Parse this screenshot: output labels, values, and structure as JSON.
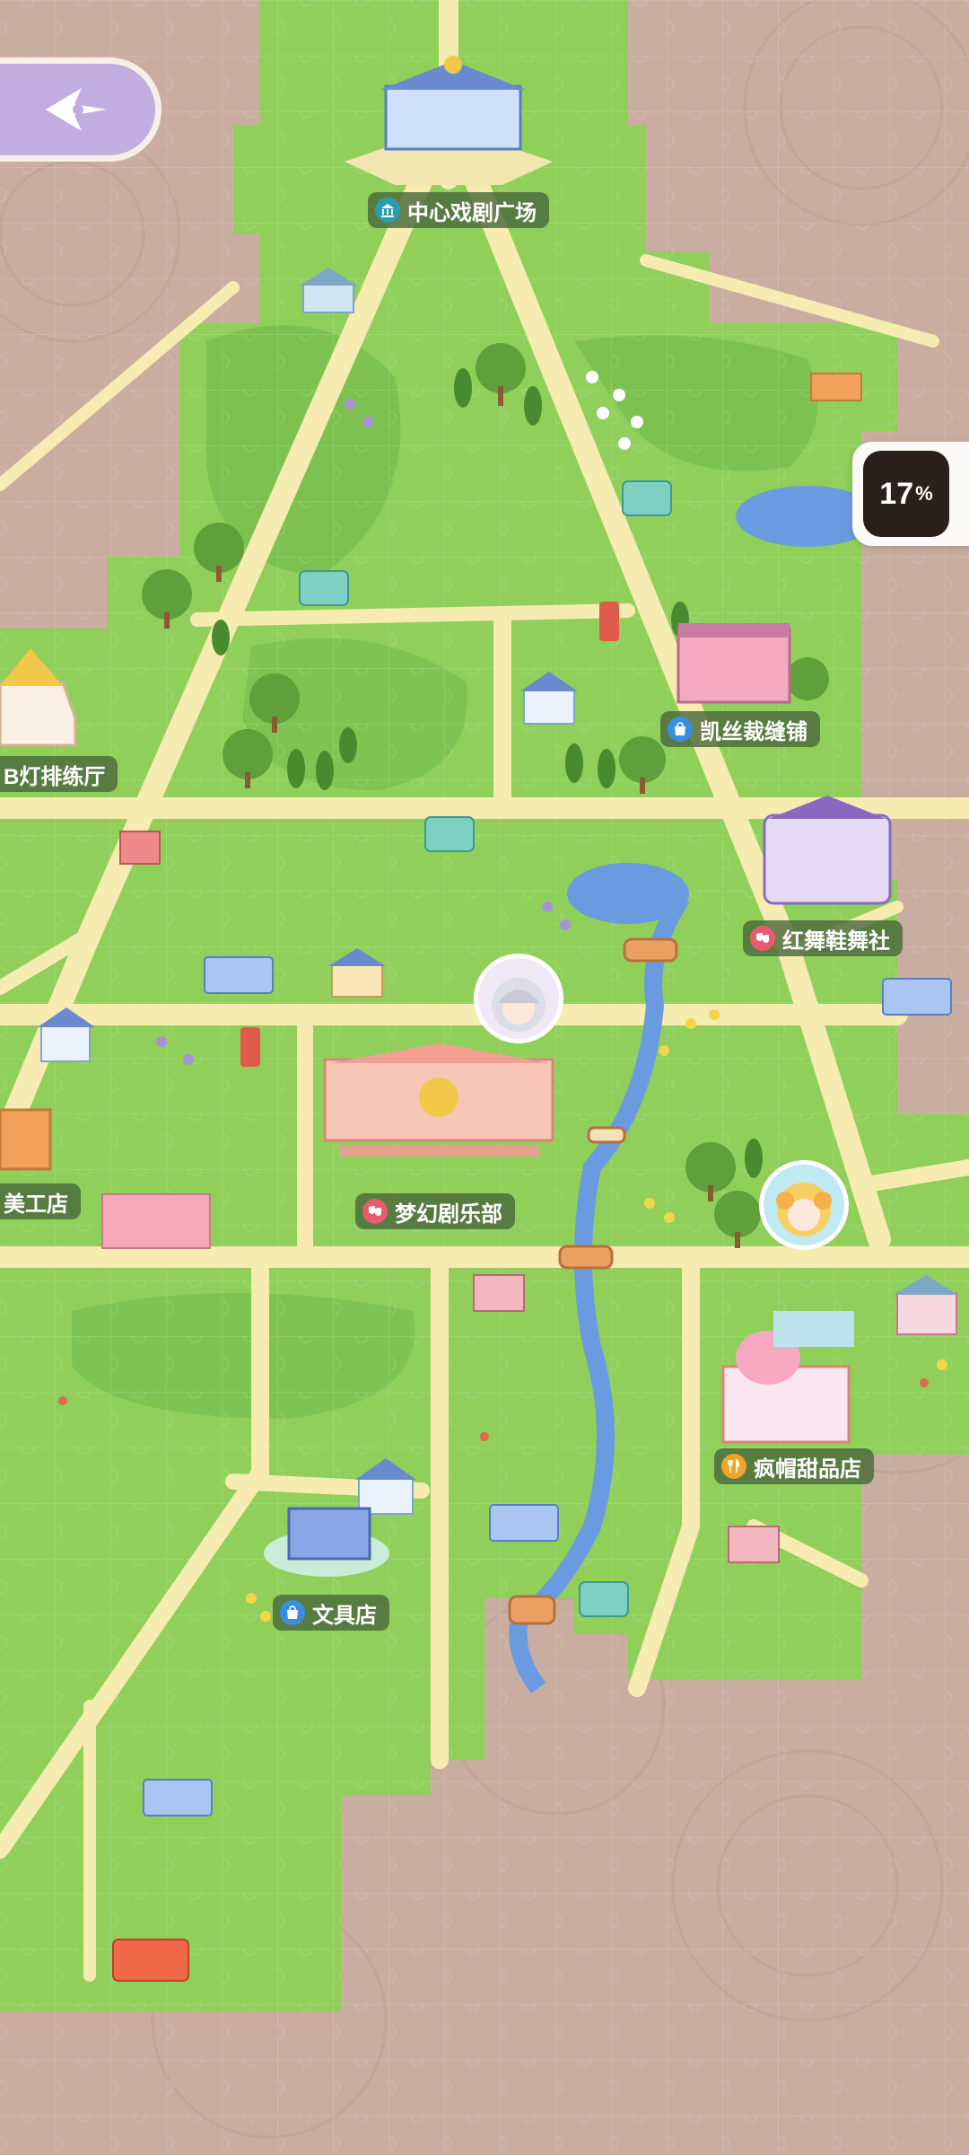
{
  "locations": [
    {
      "id": "central-theater-square",
      "label": "中心戏剧广场",
      "icon": "museum-icon",
      "color": "#2a9db3"
    },
    {
      "id": "lights-rehearsal-hall",
      "label": "B灯排练厅",
      "icon": "",
      "color": ""
    },
    {
      "id": "kaisi-tailor-shop",
      "label": "凯丝裁缝铺",
      "icon": "shopping-bag-icon",
      "color": "#3b8de0"
    },
    {
      "id": "red-dance-shoe-club",
      "label": "红舞鞋舞社",
      "icon": "theater-mask-icon",
      "color": "#e85b6d"
    },
    {
      "id": "art-shop",
      "label": "美工店",
      "icon": "",
      "color": ""
    },
    {
      "id": "dream-drama-club",
      "label": "梦幻剧乐部",
      "icon": "theater-mask-icon",
      "color": "#e85b6d"
    },
    {
      "id": "mad-hatter-dessert-shop",
      "label": "疯帽甜品店",
      "icon": "fork-knife-icon",
      "color": "#f0a42a"
    },
    {
      "id": "stationery-shop",
      "label": "文具店",
      "icon": "shopping-bag-icon",
      "color": "#3b8de0"
    }
  ],
  "collection_progress": {
    "value": "17",
    "unit": "%",
    "fraction": 0.17
  },
  "back_button": {
    "icon": "compass-arrow-icon"
  },
  "colors": {
    "background": "#c9ada0",
    "grass": "#8fcf5a",
    "grass_dark": "#6fb84a",
    "road": "#f6ebb0",
    "river": "#6a9be0",
    "label_bg": "#4a693c",
    "back_button": "#c2ace0"
  }
}
